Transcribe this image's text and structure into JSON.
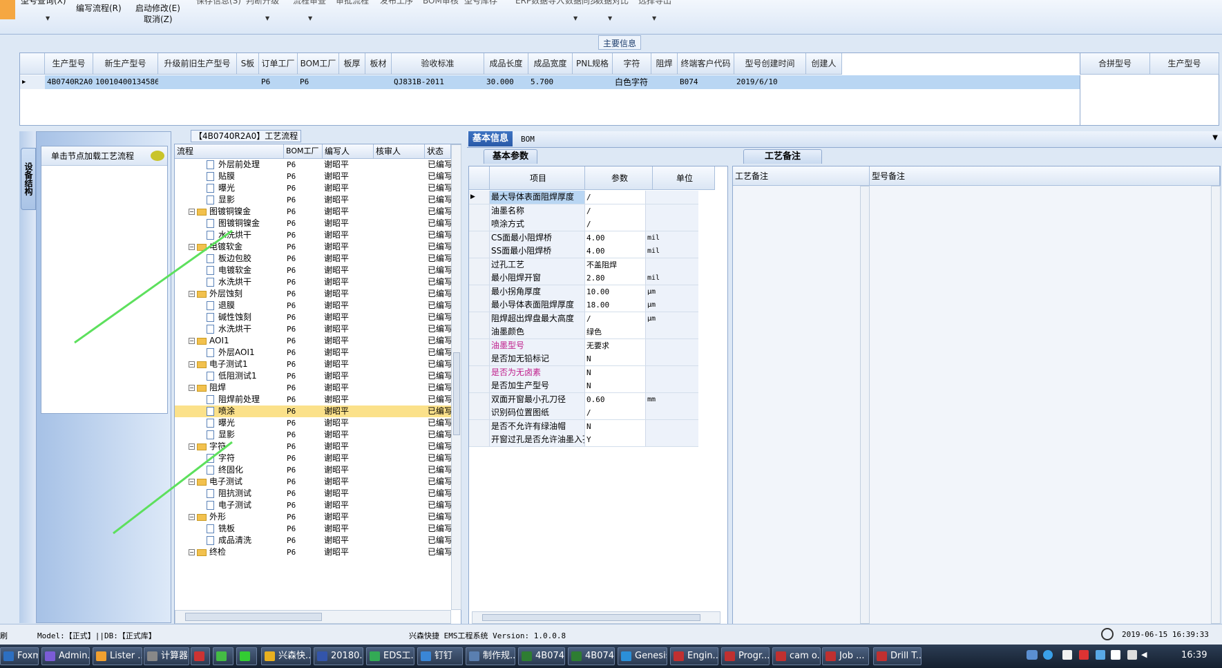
{
  "toolbar": {
    "items": [
      "编写流程(R)",
      "启动修改(E)",
      "取消(Z)"
    ],
    "truncated": [
      "型号查询(X)",
      "保存信息(S)",
      "判断升级",
      "流程审查",
      "审批流程",
      "发布工序",
      "BOM审核",
      "型号库存",
      "ERP数据导入",
      "数据同步",
      "数据对比",
      "选择导出"
    ]
  },
  "main_info": {
    "title": "主要信息",
    "columns": [
      "生产型号",
      "新生产型号",
      "升级前旧生产型号",
      "S板",
      "订单工厂",
      "BOM工厂",
      "板厚",
      "板材",
      "验收标准",
      "成品长度",
      "成品宽度",
      "PNL规格",
      "字符",
      "阻焊",
      "终端客户代码",
      "型号创建时间",
      "创建人"
    ],
    "row": [
      "4B0740R2A0",
      "10010400134586",
      "",
      "",
      "P6",
      "P6",
      "",
      "",
      "QJ831B-2011",
      "30.000",
      "5.700",
      "",
      "白色字符",
      "",
      "B074",
      "2019/6/10",
      ""
    ],
    "side_columns": [
      "合拼型号",
      "生产型号"
    ]
  },
  "left": {
    "vertical_tab": "设备结构",
    "load_hint": "单击节点加载工艺流程"
  },
  "process": {
    "title": "【4B0740R2A0】工艺流程",
    "columns": [
      "流程",
      "BOM工厂",
      "编写人",
      "核审人",
      "状态"
    ],
    "rows": [
      {
        "name": "外层前处理",
        "level": 2,
        "factory": "P6",
        "writer": "谢昭平",
        "status": "已编写"
      },
      {
        "name": "贴膜",
        "level": 2,
        "factory": "P6",
        "writer": "谢昭平",
        "status": "已编写"
      },
      {
        "name": "曝光",
        "level": 2,
        "factory": "P6",
        "writer": "谢昭平",
        "status": "已编写"
      },
      {
        "name": "显影",
        "level": 2,
        "factory": "P6",
        "writer": "谢昭平",
        "status": "已编写"
      },
      {
        "name": "图镀铜镍金",
        "level": 1,
        "factory": "P6",
        "writer": "谢昭平",
        "status": "已编写"
      },
      {
        "name": "图镀铜镍金",
        "level": 2,
        "factory": "P6",
        "writer": "谢昭平",
        "status": "已编写"
      },
      {
        "name": "水洗烘干",
        "level": 2,
        "factory": "P6",
        "writer": "谢昭平",
        "status": "已编写"
      },
      {
        "name": "电镀软金",
        "level": 1,
        "factory": "P6",
        "writer": "谢昭平",
        "status": "已编写"
      },
      {
        "name": "板边包胶",
        "level": 2,
        "factory": "P6",
        "writer": "谢昭平",
        "status": "已编写"
      },
      {
        "name": "电镀软金",
        "level": 2,
        "factory": "P6",
        "writer": "谢昭平",
        "status": "已编写"
      },
      {
        "name": "水洗烘干",
        "level": 2,
        "factory": "P6",
        "writer": "谢昭平",
        "status": "已编写"
      },
      {
        "name": "外层蚀刻",
        "level": 1,
        "factory": "P6",
        "writer": "谢昭平",
        "status": "已编写"
      },
      {
        "name": "退膜",
        "level": 2,
        "factory": "P6",
        "writer": "谢昭平",
        "status": "已编写"
      },
      {
        "name": "碱性蚀刻",
        "level": 2,
        "factory": "P6",
        "writer": "谢昭平",
        "status": "已编写"
      },
      {
        "name": "水洗烘干",
        "level": 2,
        "factory": "P6",
        "writer": "谢昭平",
        "status": "已编写"
      },
      {
        "name": "AOI1",
        "level": 1,
        "factory": "P6",
        "writer": "谢昭平",
        "status": "已编写"
      },
      {
        "name": "外层AOI1",
        "level": 2,
        "factory": "P6",
        "writer": "谢昭平",
        "status": "已编写"
      },
      {
        "name": "电子测试1",
        "level": 1,
        "factory": "P6",
        "writer": "谢昭平",
        "status": "已编写"
      },
      {
        "name": "低阻测试1",
        "level": 2,
        "factory": "P6",
        "writer": "谢昭平",
        "status": "已编写"
      },
      {
        "name": "阻焊",
        "level": 1,
        "factory": "P6",
        "writer": "谢昭平",
        "status": "已编写"
      },
      {
        "name": "阻焊前处理",
        "level": 2,
        "factory": "P6",
        "writer": "谢昭平",
        "status": "已编写"
      },
      {
        "name": "喷涂",
        "level": 2,
        "factory": "P6",
        "writer": "谢昭平",
        "status": "已编写",
        "selected": true
      },
      {
        "name": "曝光",
        "level": 2,
        "factory": "P6",
        "writer": "谢昭平",
        "status": "已编写"
      },
      {
        "name": "显影",
        "level": 2,
        "factory": "P6",
        "writer": "谢昭平",
        "status": "已编写"
      },
      {
        "name": "字符",
        "level": 1,
        "factory": "P6",
        "writer": "谢昭平",
        "status": "已编写"
      },
      {
        "name": "字符",
        "level": 2,
        "factory": "P6",
        "writer": "谢昭平",
        "status": "已编写"
      },
      {
        "name": "终固化",
        "level": 2,
        "factory": "P6",
        "writer": "谢昭平",
        "status": "已编写"
      },
      {
        "name": "电子测试",
        "level": 1,
        "factory": "P6",
        "writer": "谢昭平",
        "status": "已编写"
      },
      {
        "name": "阻抗测试",
        "level": 2,
        "factory": "P6",
        "writer": "谢昭平",
        "status": "已编写"
      },
      {
        "name": "电子测试",
        "level": 2,
        "factory": "P6",
        "writer": "谢昭平",
        "status": "已编写"
      },
      {
        "name": "外形",
        "level": 1,
        "factory": "P6",
        "writer": "谢昭平",
        "status": "已编写"
      },
      {
        "name": "铣板",
        "level": 2,
        "factory": "P6",
        "writer": "谢昭平",
        "status": "已编写"
      },
      {
        "name": "成品清洗",
        "level": 2,
        "factory": "P6",
        "writer": "谢昭平",
        "status": "已编写"
      },
      {
        "name": "终检",
        "level": 1,
        "factory": "P6",
        "writer": "谢昭平",
        "status": "已编写"
      }
    ]
  },
  "params": {
    "tab_basic": "基本信息",
    "tab_bom": "BOM",
    "subtab": "基本参数",
    "columns": [
      "项目",
      "参数",
      "单位"
    ],
    "rows": [
      {
        "item": "最大导体表面阻焊厚度",
        "value": "/",
        "unit": ""
      },
      {
        "item": "油墨名称",
        "value": "/",
        "unit": ""
      },
      {
        "item": "喷涂方式",
        "value": "/",
        "unit": ""
      },
      {
        "item": "CS面最小阻焊桥",
        "value": "4.00",
        "unit": "mil"
      },
      {
        "item": "SS面最小阻焊桥",
        "value": "4.00",
        "unit": "mil"
      },
      {
        "item": "过孔工艺",
        "value": "不盖阻焊",
        "unit": ""
      },
      {
        "item": "最小阻焊开窗",
        "value": "2.80",
        "unit": "mil"
      },
      {
        "item": "最小拐角厚度",
        "value": "10.00",
        "unit": "μm"
      },
      {
        "item": "最小导体表面阻焊厚度",
        "value": "18.00",
        "unit": "μm"
      },
      {
        "item": "阻焊超出焊盘最大高度",
        "value": "/",
        "unit": "μm"
      },
      {
        "item": "油墨颜色",
        "value": "绿色",
        "unit": ""
      },
      {
        "item": "油墨型号",
        "value": "无要求",
        "unit": "",
        "highlight": true
      },
      {
        "item": "是否加无铅标记",
        "value": "N",
        "unit": ""
      },
      {
        "item": "是否为无卤素",
        "value": "N",
        "unit": "",
        "highlight": true
      },
      {
        "item": "是否加生产型号",
        "value": "N",
        "unit": ""
      },
      {
        "item": "双面开窗最小孔刀径",
        "value": "0.60",
        "unit": "mm"
      },
      {
        "item": "识别码位置图纸",
        "value": "/",
        "unit": ""
      },
      {
        "item": "是否不允许有绿油帽",
        "value": "N",
        "unit": ""
      },
      {
        "item": "开窗过孔是否允许油墨入孔",
        "value": "Y",
        "unit": ""
      }
    ]
  },
  "notes": {
    "tab": "工艺备注",
    "col1": "工艺备注",
    "col2": "型号备注"
  },
  "status": {
    "left_fragment": "刷",
    "model": "Model:【正式】||DB:【正式库】",
    "app": "兴森快捷 EMS工程系统 Version: 1.0.0.8",
    "datetime": "2019-06-15 16:39:33"
  },
  "taskbar": {
    "tasks": [
      "Foxmail",
      "Admin...",
      "Lister ...",
      "计算器",
      "",
      "",
      "",
      "兴森快...",
      "20180...",
      "EDS工...",
      "钉钉",
      "制作规...",
      "4B074...",
      "4B074...",
      "Genesis",
      "Engin...",
      "Progr...",
      "cam o...",
      "Job ...",
      "Drill T..."
    ],
    "clock": "16:39"
  },
  "colors": {
    "selection": "#b9d6f3",
    "tree_selected": "#fbe18a",
    "accent": "#2a5aa8",
    "highlight_text": "#c0208c"
  }
}
